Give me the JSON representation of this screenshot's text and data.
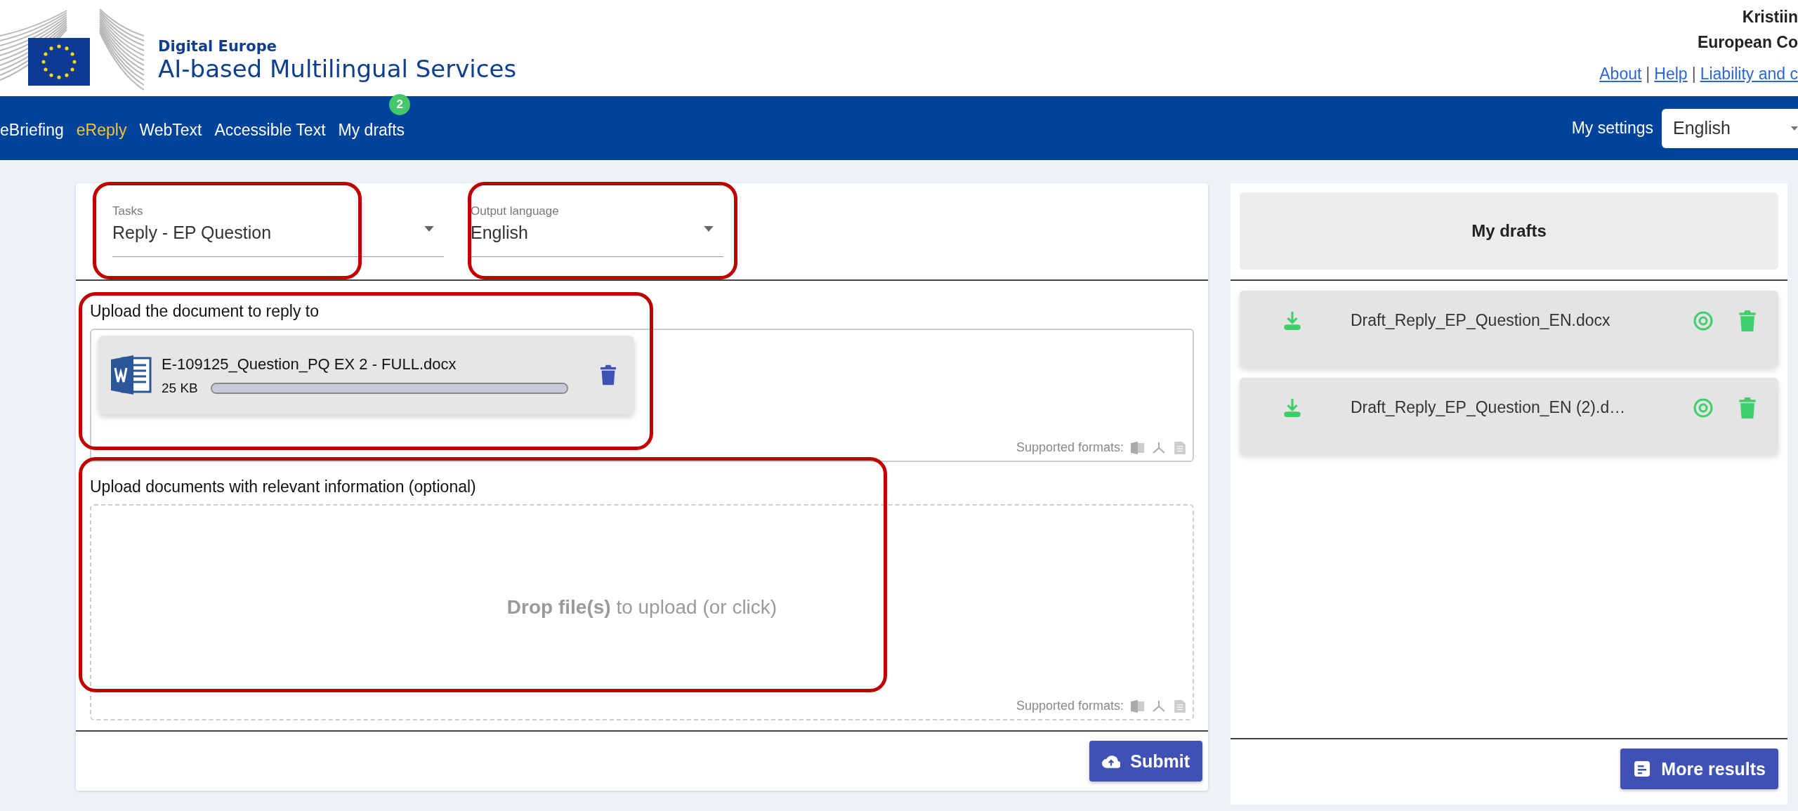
{
  "header": {
    "subtitle": "Digital Europe",
    "title": "AI-based Multilingual Services",
    "user_name": "Kristiin",
    "organisation": "European Co",
    "links": [
      "About",
      "Help",
      "Liability and c"
    ],
    "separators": [
      "|",
      "|"
    ]
  },
  "nav": {
    "items": [
      {
        "label": "eBriefing",
        "selected": false
      },
      {
        "label": "eReply",
        "selected": true
      },
      {
        "label": "WebText",
        "selected": false
      },
      {
        "label": "Accessible Text",
        "selected": false
      },
      {
        "label": "My drafts",
        "selected": false,
        "badge": "2"
      }
    ],
    "settings_label": "My settings",
    "language": "English"
  },
  "form": {
    "fields": [
      {
        "label": "Tasks",
        "value": "Reply - EP Question"
      },
      {
        "label": "Output language",
        "value": "English"
      }
    ],
    "upload": {
      "label": "Upload the document to reply to",
      "file": {
        "name": "E-109125_Question_PQ EX 2 - FULL.docx",
        "size": "25 KB",
        "level": 1
      },
      "formats_label": "Supported formats:"
    },
    "optional_upload": {
      "label": "Upload documents with relevant information (optional)",
      "drop_text": "**Drop file(s)** to upload (or click)",
      "formats_label": "Supported formats:"
    },
    "submit": "Submit"
  },
  "drafts": {
    "title": "My drafts",
    "items": [
      {
        "name": "Draft_Reply_EP_Question_EN.docx"
      },
      {
        "name": "Draft_Reply_EP_Question_EN (2).d…"
      }
    ],
    "more_button": "More results"
  }
}
